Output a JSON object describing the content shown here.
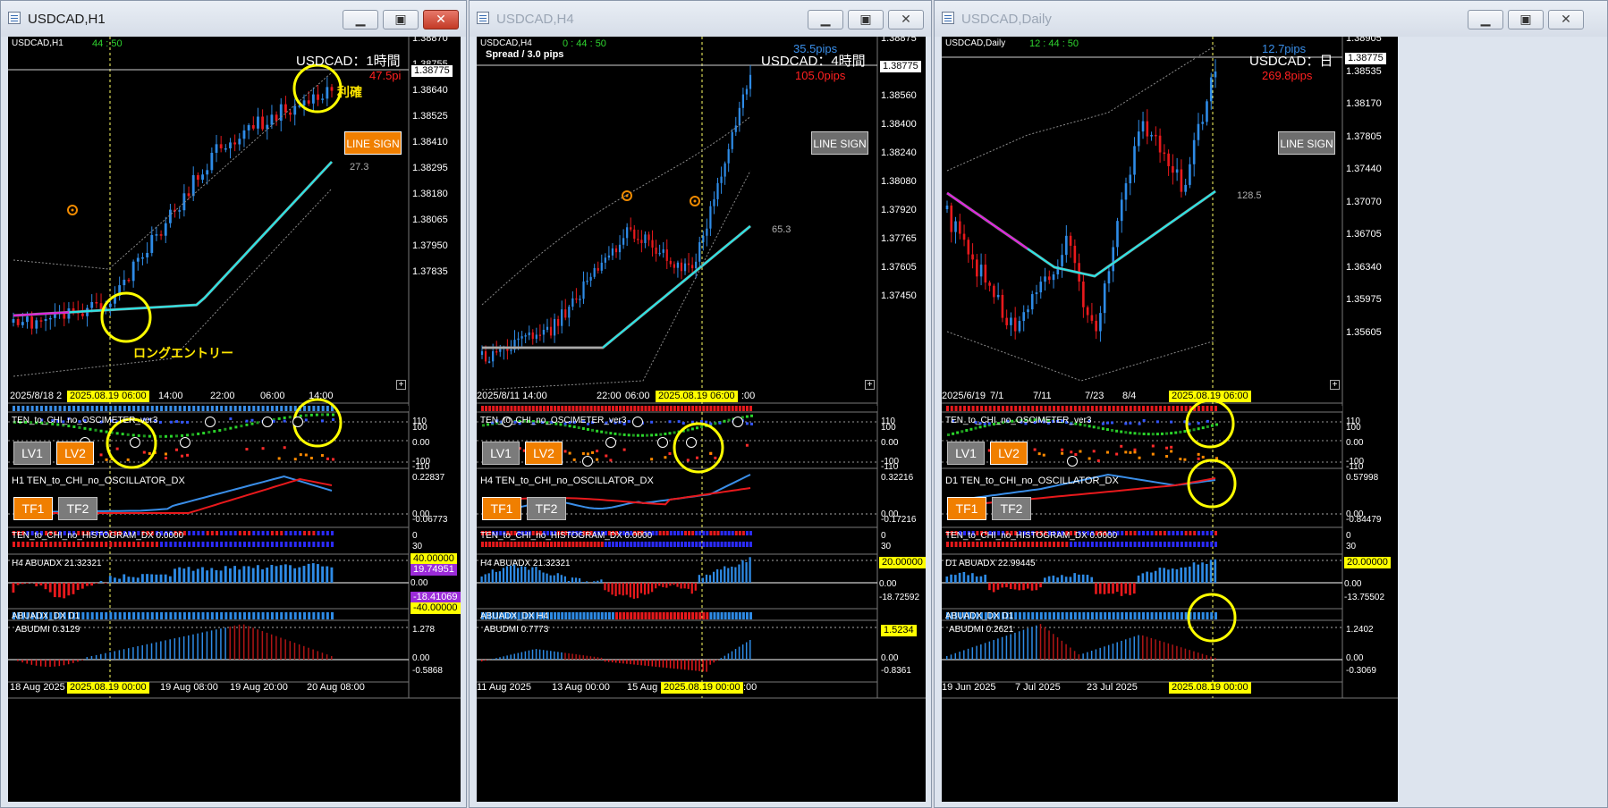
{
  "windows": [
    {
      "title": "USDCAD,H1",
      "symbol_label": "USDCAD,H1",
      "counter": "44 : 50",
      "spread": "",
      "header_big": "USDCAD：1時間",
      "pips_a": "",
      "pips_b": "47.5pi",
      "pips_top_partial": "pi",
      "annot_profit": "利確",
      "annot_entry": "ロングエントリー",
      "line_sign": "LINE SIGN",
      "ma_value": "27.3",
      "price_axis": [
        "1.38870",
        "1.38755",
        "1.38640",
        "1.38525",
        "1.38410",
        "1.38295",
        "1.38180",
        "1.38065",
        "1.37950",
        "1.37835"
      ],
      "current_price": "1.38775",
      "time_axis_main": [
        "2025/8/18 2",
        "2025.08.19 06:00",
        "14:00",
        "22:00",
        "06:00",
        "14:00"
      ],
      "osc_title": "TEN_to_CHI_no_OSCIMETER_ver3",
      "osc_axis": [
        "110",
        "100",
        "0.00",
        "-100",
        "-110"
      ],
      "lv1": "LV1",
      "lv2": "LV2",
      "oscx_title": "H1 TEN_to_CHI_no_OSCILLATOR_DX",
      "oscx_axis": [
        "0.22837",
        "0.00",
        "-0.06773"
      ],
      "tf1": "TF1",
      "tf2": "TF2",
      "hist_title": "TEN_to_CHI_no_HISTOGRAM_DX 0.0000",
      "hist_axis": [
        "0",
        "30"
      ],
      "adx_title": "H4 ABUADX  21.32321",
      "adx_axis": [
        "40.00000",
        "19.74951",
        "0.00",
        "-18.41069",
        "-40.00000"
      ],
      "adxdx_title": "ABUADX_DX D1",
      "dmi_title": "ABUDMI  0.3129",
      "dmi_axis": [
        "1.278",
        "0.00",
        "-0.5868"
      ],
      "time_axis_bottom": [
        "18 Aug 2025",
        "2025.08.19 00:00",
        "19 Aug 08:00",
        "19 Aug 20:00",
        "20 Aug 08:00"
      ]
    },
    {
      "title": "USDCAD,H4",
      "symbol_label": "USDCAD,H4",
      "counter": "0 : 44 : 50",
      "spread": "Spread / 3.0 pips",
      "header_big": "USDCAD：4時間",
      "pips_a": "35.5pips",
      "pips_b": "105.0pips",
      "line_sign": "LINE SIGN",
      "ma_value": "65.3",
      "price_axis": [
        "1.38875",
        "1.38715",
        "1.38560",
        "1.38400",
        "1.38240",
        "1.38080",
        "1.37920",
        "1.37765",
        "1.37605",
        "1.37450"
      ],
      "current_price": "1.38775",
      "time_axis_main": [
        "2025/8/11 14:00",
        "22:00",
        "06:00",
        "2025.08.19 06:00",
        ":00"
      ],
      "osc_title": "TEN_to_CHI_no_OSCIMETER_ver3",
      "osc_axis": [
        "110",
        "100",
        "0.00",
        "-100",
        "-110"
      ],
      "lv1": "LV1",
      "lv2": "LV2",
      "oscx_title": "H4 TEN_to_CHI_no_OSCILLATOR_DX",
      "oscx_axis": [
        "0.32216",
        "0.00",
        "-0.17216"
      ],
      "tf1": "TF1",
      "tf2": "TF2",
      "hist_title": "TEN_to_CHI_no_HISTOGRAM_DX 0.0000",
      "hist_axis": [
        "0",
        "30"
      ],
      "adx_title": "H4 ABUADX  21.32321",
      "adx_axis": [
        "20.00000",
        "0.00",
        "-18.72592"
      ],
      "adxdx_title": "ABUADX_DX H4",
      "dmi_title": "ABUDMI  0.7773",
      "dmi_axis": [
        "1.5234",
        "0.00",
        "-0.8361"
      ],
      "time_axis_bottom": [
        "11 Aug 2025",
        "13 Aug 00:00",
        "15 Aug",
        "2025.08.19 00:00",
        ":00"
      ]
    },
    {
      "title": "USDCAD,Daily",
      "symbol_label": "USDCAD,Daily",
      "counter": "12 : 44 : 50",
      "spread": "",
      "header_big": "USDCAD：日",
      "pips_a": "12.7pips",
      "pips_b": "269.8pips",
      "line_sign": "LINE SIGN",
      "ma_value": "128.5",
      "price_axis": [
        "1.38905",
        "1.38535",
        "1.38170",
        "1.37805",
        "1.37440",
        "1.37070",
        "1.36705",
        "1.36340",
        "1.35975",
        "1.35605"
      ],
      "current_price": "1.38775",
      "time_axis_main": [
        "2025/6/19",
        "7/1",
        "7/11",
        "7/23",
        "8/4",
        "2025.08.19 06:00"
      ],
      "osc_title": "TEN_to_CHI_no_OSCIMETER_ver3",
      "osc_axis": [
        "110",
        "100",
        "0.00",
        "-100",
        "-110"
      ],
      "lv1": "LV1",
      "lv2": "LV2",
      "oscx_title": "D1 TEN_to_CHI_no_OSCILLATOR_DX",
      "oscx_axis": [
        "0.57998",
        "0.00",
        "-0.84479"
      ],
      "tf1": "TF1",
      "tf2": "TF2",
      "hist_title": "TEN_to_CHI_no_HISTOGRAM_DX 0.0000",
      "hist_axis": [
        "0",
        "30"
      ],
      "adx_title": "D1 ABUADX  22.99445",
      "adx_axis": [
        "20.00000",
        "0.00",
        "-13.75502"
      ],
      "adxdx_title": "ABUADX_DX D1",
      "dmi_title": "ABUDMI  0.2621",
      "dmi_axis": [
        "1.2402",
        "0.00",
        "-0.3069"
      ],
      "time_axis_bottom": [
        "19 Jun 2025",
        "7 Jul 2025",
        "23 Jul 2025",
        "2025.08.19 00:00"
      ]
    }
  ],
  "colors": {
    "bull": "#2e8be6",
    "bear": "#e8191c",
    "ma": "#27e6e6",
    "ma_down": "#e020e0",
    "bg": "#000000",
    "highlight": "#ffff00"
  }
}
